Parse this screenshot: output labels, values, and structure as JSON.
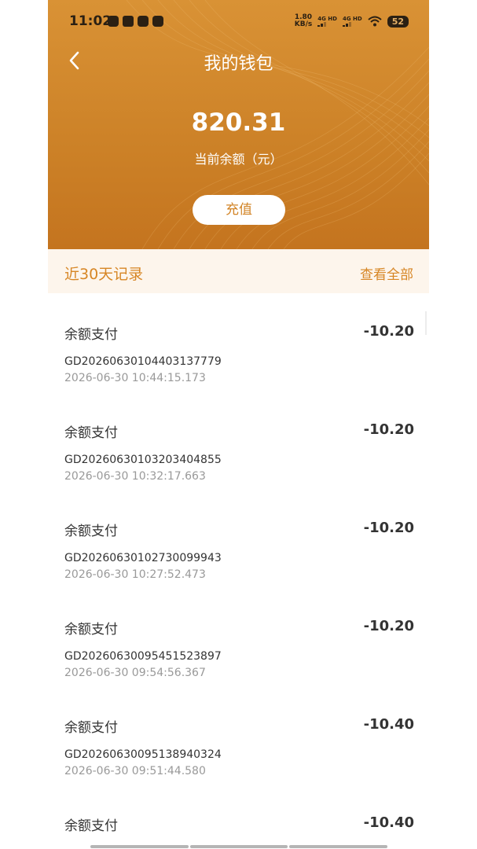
{
  "status_bar": {
    "time": "11:02",
    "net_speed_value": "1.80",
    "net_speed_unit": "KB/s",
    "signal_1": "4G HD",
    "signal_2": "4G HD",
    "battery": "52"
  },
  "header": {
    "title": "我的钱包",
    "balance": "820.31",
    "balance_label": "当前余额（元）",
    "recharge_label": "充值"
  },
  "records": {
    "title": "近30天记录",
    "view_all": "查看全部",
    "items": [
      {
        "type": "余额支付",
        "amount": "-10.20",
        "order": "GD20260630104403137779",
        "time": "2026-06-30 10:44:15.173"
      },
      {
        "type": "余额支付",
        "amount": "-10.20",
        "order": "GD20260630103203404855",
        "time": "2026-06-30 10:32:17.663"
      },
      {
        "type": "余额支付",
        "amount": "-10.20",
        "order": "GD20260630102730099943",
        "time": "2026-06-30 10:27:52.473"
      },
      {
        "type": "余额支付",
        "amount": "-10.20",
        "order": "GD20260630095451523897",
        "time": "2026-06-30 09:54:56.367"
      },
      {
        "type": "余额支付",
        "amount": "-10.40",
        "order": "GD20260630095138940324",
        "time": "2026-06-30 09:51:44.580"
      },
      {
        "type": "余额支付",
        "amount": "-10.40",
        "order": "",
        "time": ""
      }
    ]
  },
  "colors": {
    "header_bg": "#cc8127",
    "accent": "#d78625",
    "record_bar_bg": "#fdf5ec"
  }
}
